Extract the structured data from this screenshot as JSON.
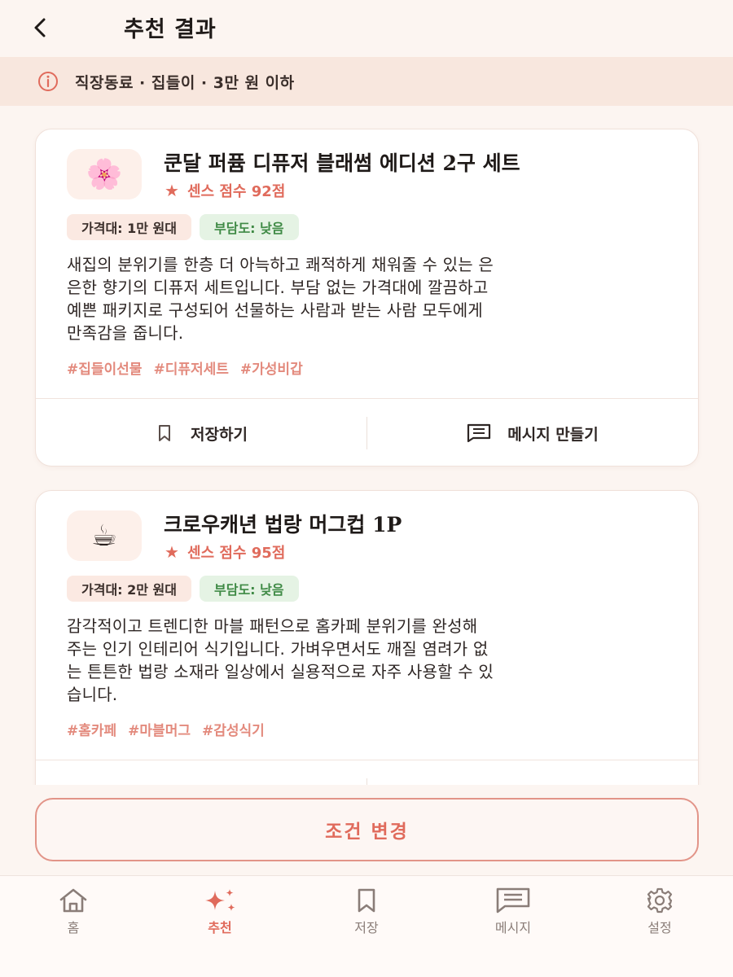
{
  "header": {
    "title": "추천 결과",
    "back_icon": "chevron-left-icon"
  },
  "filter": {
    "icon": "info-icon",
    "text": "직장동료 · 집들이 · 3만 원 이하"
  },
  "cards": [
    {
      "thumb": "🌸",
      "name": "쿤달 퍼퓸 디퓨저 블래썸 에디션 2구 세트",
      "score": "센스 점수 92점",
      "price_badge": "가격대: 1만 원대",
      "burden_badge": "부담도: 낮음",
      "desc_lines": [
        "새집의 분위기를 한층 더 아늑하고 쾌적하게 채워줄 수 있는 은",
        "은한 향기의 디퓨저 세트입니다. 부담 없는 가격대에 깔끔하고",
        "예쁜 패키지로 구성되어 선물하는 사람과 받는 사람 모두에게",
        "만족감을 줍니다."
      ],
      "tags": [
        "#집들이선물",
        "#디퓨저세트",
        "#가성비갑"
      ],
      "save_label": "저장하기",
      "message_label": "메시지 만들기"
    },
    {
      "thumb": "☕",
      "name": "크로우캐년 법랑 머그컵 1P",
      "score": "센스 점수 95점",
      "price_badge": "가격대: 2만 원대",
      "burden_badge": "부담도: 낮음",
      "desc_lines": [
        "감각적이고 트렌디한 마블 패턴으로 홈카페 분위기를 완성해",
        "주는 인기 인테리어 식기입니다. 가벼우면서도 깨질 염려가 없",
        "는 튼튼한 법랑 소재라 일상에서 실용적으로 자주 사용할 수 있",
        "습니다."
      ],
      "tags": [
        "#홈카페",
        "#마블머그",
        "#감성식기"
      ]
    }
  ],
  "change_button": "조건 변경",
  "nav": [
    {
      "label": "홈",
      "icon": "home-icon",
      "active": false
    },
    {
      "label": "추천",
      "icon": "sparkle-icon",
      "active": true
    },
    {
      "label": "저장",
      "icon": "bookmark-icon",
      "active": false
    },
    {
      "label": "메시지",
      "icon": "message-icon",
      "active": false
    },
    {
      "label": "설정",
      "icon": "gear-icon",
      "active": false
    }
  ],
  "colors": {
    "accent": "#e06b5c",
    "background": "#fcf5f1",
    "filter_bg": "#f8e7de",
    "burden_green": "#3f8a45"
  }
}
